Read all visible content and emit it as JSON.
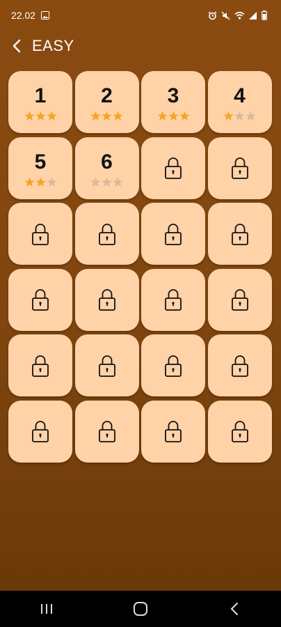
{
  "status_bar": {
    "time": "22.02",
    "icons": [
      "gallery-icon",
      "alarm-icon",
      "mute-icon",
      "wifi-icon",
      "signal-icon",
      "battery-icon"
    ]
  },
  "header": {
    "back_icon": "chevron-left-icon",
    "title": "EASY"
  },
  "colors": {
    "background_top": "#8a4b10",
    "tile": "#ffd2a8",
    "star_filled": "#f5a623",
    "star_empty": "#d9b99a"
  },
  "levels": [
    {
      "number": "1",
      "locked": false,
      "stars": 3
    },
    {
      "number": "2",
      "locked": false,
      "stars": 3
    },
    {
      "number": "3",
      "locked": false,
      "stars": 3
    },
    {
      "number": "4",
      "locked": false,
      "stars": 1
    },
    {
      "number": "5",
      "locked": false,
      "stars": 2
    },
    {
      "number": "6",
      "locked": false,
      "stars": 0
    },
    {
      "locked": true
    },
    {
      "locked": true
    },
    {
      "locked": true
    },
    {
      "locked": true
    },
    {
      "locked": true
    },
    {
      "locked": true
    },
    {
      "locked": true
    },
    {
      "locked": true
    },
    {
      "locked": true
    },
    {
      "locked": true
    },
    {
      "locked": true
    },
    {
      "locked": true
    },
    {
      "locked": true
    },
    {
      "locked": true
    },
    {
      "locked": true
    },
    {
      "locked": true
    },
    {
      "locked": true
    },
    {
      "locked": true
    }
  ],
  "nav_bar": {
    "items": [
      "recent-apps-icon",
      "home-icon",
      "back-icon"
    ]
  }
}
